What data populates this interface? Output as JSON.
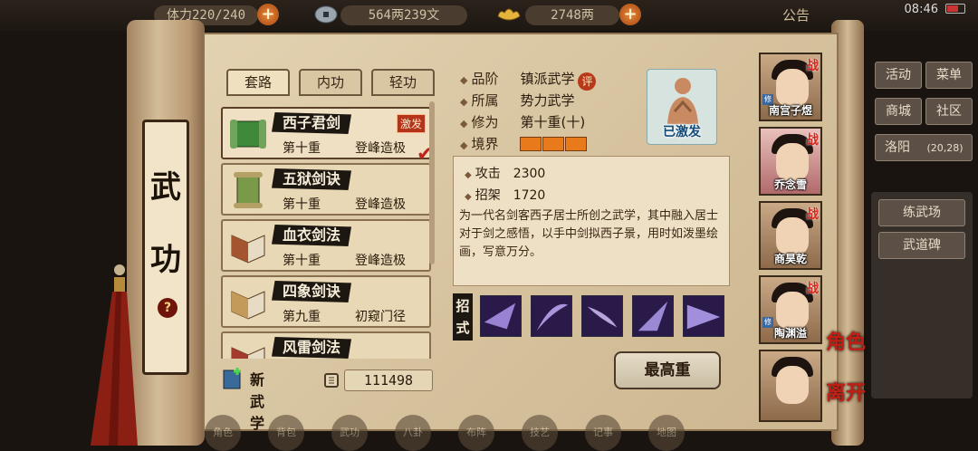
{
  "status_bar": {
    "stamina": "体力220/240",
    "money": "564两239文",
    "gold": "2748两",
    "notice": "公告",
    "time": "08:46"
  },
  "scroll_title": [
    "武",
    "功"
  ],
  "tabs": [
    {
      "label": "套路",
      "active": true
    },
    {
      "label": "内功",
      "active": false
    },
    {
      "label": "轻功",
      "active": false
    }
  ],
  "skills": [
    {
      "name": "西子君剑",
      "level": "第十重",
      "rank": "登峰造极",
      "badge": "激发",
      "selected": true
    },
    {
      "name": "五狱剑诀",
      "level": "第十重",
      "rank": "登峰造极",
      "badge": "",
      "selected": false
    },
    {
      "name": "血衣剑法",
      "level": "第十重",
      "rank": "登峰造极",
      "badge": "",
      "selected": false
    },
    {
      "name": "四象剑诀",
      "level": "第九重",
      "rank": "初窥门径",
      "badge": "",
      "selected": false
    },
    {
      "name": "风雷剑法",
      "level": "",
      "rank": "",
      "badge": "",
      "selected": false
    }
  ],
  "new_skill": {
    "label": "新武学"
  },
  "points": "111498",
  "info": {
    "grade_key": "品阶",
    "grade": "镇派武学",
    "grade_badge": "评",
    "belong_key": "所属",
    "belong": "势力武学",
    "cultivation_key": "修为",
    "cultivation": "第十重(十)",
    "realm_key": "境界",
    "realm_segments": 3
  },
  "portrait_label": "已激发",
  "stats": [
    {
      "key": "攻击",
      "value": "2300"
    },
    {
      "key": "招架",
      "value": "1720"
    }
  ],
  "description": "为一代名剑客西子居士所创之武学，其中融入居士对于剑之感悟，以手中剑拟西子景，用时如泼墨绘画，写意万分。",
  "moves_label": [
    "招",
    "式"
  ],
  "max_button": "最高重",
  "characters": [
    {
      "name": "南宫子煜",
      "war": "战",
      "selected": false,
      "xiu": "修"
    },
    {
      "name": "乔念雪",
      "war": "战",
      "selected": true,
      "xiu": ""
    },
    {
      "name": "商昊乾",
      "war": "战",
      "selected": false,
      "xiu": ""
    },
    {
      "name": "陶渊溢",
      "war": "战",
      "selected": false,
      "xiu": "修"
    },
    {
      "name": "",
      "war": "",
      "selected": false,
      "xiu": ""
    }
  ],
  "side_labels": [
    "角色",
    "离开"
  ],
  "right_menu": {
    "activity": "活动",
    "menu": "菜单",
    "mall": "商城",
    "community": "社区",
    "location": "洛阳",
    "location_count": "(20,28)",
    "training": "练武场",
    "stele": "武道碑"
  },
  "bottom_nav": [
    "角色",
    "背包",
    "武功",
    "八卦",
    "布阵",
    "技艺",
    "记事",
    "地图"
  ]
}
